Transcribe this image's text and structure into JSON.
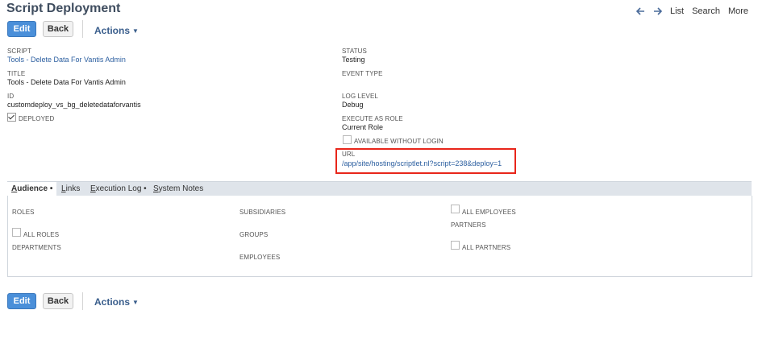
{
  "page": {
    "title": "Script Deployment"
  },
  "topnav": {
    "back_arrow": "arrow-left-icon",
    "forward_arrow": "arrow-right-icon",
    "list": "List",
    "search": "Search",
    "more": "More"
  },
  "toolbar": {
    "edit": "Edit",
    "back": "Back",
    "actions": "Actions"
  },
  "fields": {
    "script_label": "SCRIPT",
    "script_value": "Tools - Delete Data For Vantis Admin",
    "title_label": "TITLE",
    "title_value": "Tools - Delete Data For Vantis Admin",
    "id_label": "ID",
    "id_value": "customdeploy_vs_bg_deletedataforvantis",
    "deployed_label": "DEPLOYED",
    "deployed_checked": true,
    "status_label": "STATUS",
    "status_value": "Testing",
    "event_type_label": "EVENT TYPE",
    "event_type_value": "",
    "log_level_label": "LOG LEVEL",
    "log_level_value": "Debug",
    "execute_as_role_label": "EXECUTE AS ROLE",
    "execute_as_role_value": "Current Role",
    "available_without_login_label": "AVAILABLE WITHOUT LOGIN",
    "available_without_login_checked": false,
    "url_label": "URL",
    "url_value": "/app/site/hosting/scriptlet.nl?script=238&deploy=1"
  },
  "highlight": {
    "color": "#e8261b"
  },
  "tabs": [
    {
      "first": "A",
      "rest": "udience",
      "suffix": "•",
      "active": true
    },
    {
      "first": "L",
      "rest": "inks",
      "suffix": "",
      "active": false
    },
    {
      "first": "E",
      "rest": "xecution Log",
      "suffix": "•",
      "active": false
    },
    {
      "first": "S",
      "rest": "ystem Notes",
      "suffix": "",
      "active": false
    }
  ],
  "audience": {
    "roles": "ROLES",
    "all_roles": "ALL ROLES",
    "departments": "DEPARTMENTS",
    "subsidiaries": "SUBSIDIARIES",
    "groups": "GROUPS",
    "employees": "EMPLOYEES",
    "all_employees": "ALL EMPLOYEES",
    "partners": "PARTNERS",
    "all_partners": "ALL PARTNERS"
  },
  "colors": {
    "primary_button": "#4a8fd9",
    "link": "#2c5fa0",
    "title": "#3f4d5f"
  }
}
